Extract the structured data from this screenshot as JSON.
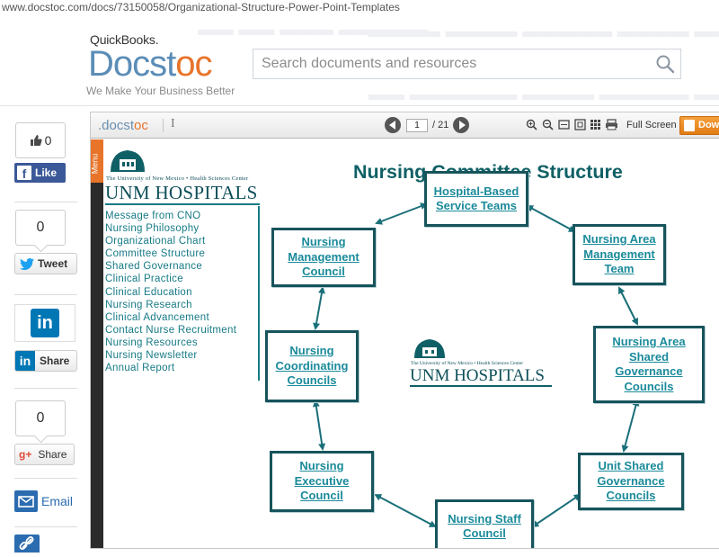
{
  "browser": {
    "url": "www.docstoc.com/docs/73150058/Organizational-Structure-Power-Point-Templates"
  },
  "header": {
    "brand_prefix": "QuickBooks.",
    "logo_part1": "Docst",
    "logo_part2": "oc",
    "tagline": "We Make Your Business Better",
    "search_placeholder": "Search documents and resources"
  },
  "social": {
    "like_count": "0",
    "like_label": "Like",
    "tweet_count": "0",
    "tweet_label": "Tweet",
    "linkedin_label": "Share",
    "gplus_count": "0",
    "gplus_label": "Share",
    "email_label": "Email"
  },
  "viewer": {
    "logo_part1": ".docst",
    "logo_part2": "oc",
    "cursor_glyph": "I",
    "current_page": "1",
    "total_pages": "/ 21",
    "fullscreen_label": "Full Screen",
    "download_label": "Dow",
    "menu_label": "Menu"
  },
  "slide": {
    "university_line": "The University of New Mexico • Health Sciences Center",
    "hospital_name": "UNM HOSPITALS",
    "title": "Nursing Committee Structure",
    "nav_links": [
      "Message from CNO",
      "Nursing Philosophy",
      "Organizational Chart",
      "Committee Structure",
      "Shared Governance",
      "Clinical Practice",
      "Clinical Education",
      "Nursing Research",
      "Clinical Advancement",
      "Contact Nurse Recruitment",
      "Nursing Resources",
      "Nursing Newsletter",
      "Annual Report"
    ],
    "nodes": {
      "hospital_based": "Hospital-Based\nService Teams",
      "area_mgmt": "Nursing Area\nManagement\nTeam",
      "area_shared": "Nursing Area\nShared\nGovernance\nCouncils",
      "unit_shared": "Unit Shared\nGovernance\nCouncils",
      "staff_council": "Nursing Staff\nCouncil",
      "exec_council": "Nursing\nExecutive\nCouncil",
      "coord_councils": "Nursing\nCoordinating\nCouncils",
      "mgmt_council": "Nursing\nManagement\nCouncil"
    }
  },
  "colors": {
    "accent_orange": "#e8742a",
    "docstoc_blue": "#5b8db7",
    "teal_text": "#1a8a9a",
    "teal_dark": "#17545c",
    "facebook": "#3b5998",
    "twitter": "#1da1f2",
    "linkedin": "#0077b5",
    "gplus": "#dd4b39"
  }
}
